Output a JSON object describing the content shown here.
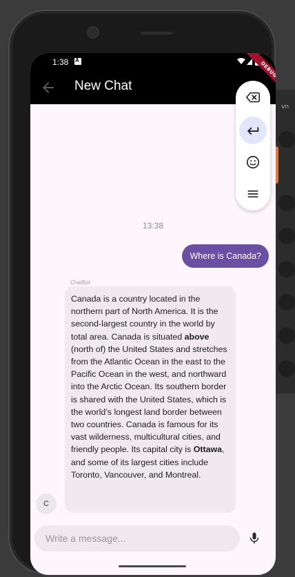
{
  "status_bar": {
    "time": "1:38",
    "notification_icon": "a-badge-icon"
  },
  "app_bar": {
    "title": "New Chat",
    "back_icon": "arrow-back-icon"
  },
  "debug_banner": {
    "label": "DEBUG"
  },
  "toolbar": {
    "buttons": [
      {
        "icon": "backspace-icon"
      },
      {
        "icon": "return-arrow-icon",
        "active": true
      },
      {
        "icon": "emoji-icon"
      },
      {
        "icon": "menu-icon"
      }
    ]
  },
  "chat": {
    "timestamp": "13:38",
    "user_message": "Where is Canada?",
    "bot_author": "ChatBot",
    "bot_avatar_initial": "C",
    "bot_message": {
      "part1": "Canada is a country located in the northern part of North America. It is the second-largest country in the world by total area. Canada is situated ",
      "bold1": "above",
      "part2": " (north of) the United States and stretches from the Atlantic Ocean in the east to the Pacific Ocean in the west, and northward into the Arctic Ocean. Its southern border is shared with the United States, which is the world’s longest land border between two countries. Canada is famous for its vast wilderness, multicultural cities, and friendly people. Its capital city is ",
      "bold2": "Ottawa",
      "part3": ", and some of its largest cities include Toronto, Vancouver, and Montreal."
    }
  },
  "composer": {
    "placeholder": "Write a message...",
    "value": "",
    "mic_icon": "microphone-icon"
  },
  "background": {
    "partial_text": "vn"
  },
  "colors": {
    "user_bubble": "#6a4fa3",
    "bot_bubble": "#f0eaf0",
    "screen_bg": "#fdf6fd",
    "toolbar_active": "#e2e6fa"
  }
}
